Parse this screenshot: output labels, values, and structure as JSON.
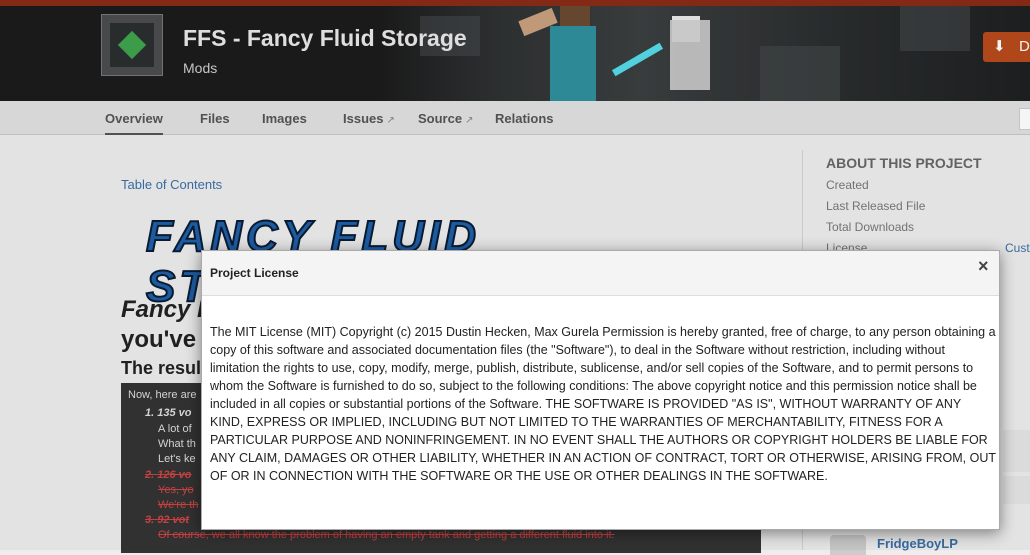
{
  "project": {
    "title": "FFS - Fancy Fluid Storage",
    "category": "Mods",
    "download_label": "D"
  },
  "nav": {
    "tabs": [
      {
        "label": "Overview",
        "external": false
      },
      {
        "label": "Files",
        "external": false
      },
      {
        "label": "Images",
        "external": false
      },
      {
        "label": "Issues",
        "external": true
      },
      {
        "label": "Source",
        "external": true
      },
      {
        "label": "Relations",
        "external": false
      }
    ],
    "external_icon": "external-link-icon"
  },
  "content": {
    "toc_label": "Table of Contents",
    "banner_text": "FANCY FLUID STORAGE",
    "heading_line1": "Fancy F",
    "heading_line2": "you've",
    "results_heading": "The resul",
    "list_intro": "Now, here are",
    "list": [
      {
        "num": "1.",
        "text": "135 vo",
        "struck": false
      },
      {
        "num": "",
        "text": "A lot of",
        "struck": false
      },
      {
        "num": "",
        "text": "What th",
        "struck": false
      },
      {
        "num": "",
        "text": "Let's ke",
        "struck": false
      },
      {
        "num": "2.",
        "text": "126 vo",
        "struck": true
      },
      {
        "num": "",
        "text": "Yes, yo",
        "struck": true
      },
      {
        "num": "",
        "text": "We're th",
        "struck": true
      },
      {
        "num": "3.",
        "text": "92 vot",
        "struck": true
      },
      {
        "num": "",
        "text": "Of course, we all know the problem of having an empty tank and getting a different fluid into it.",
        "struck": true
      }
    ]
  },
  "sidebar": {
    "title": "ABOUT THIS PROJECT",
    "rows": [
      "Created",
      "Last Released File",
      "Total Downloads",
      "License"
    ],
    "license_link": "Cust",
    "member_name": "FridgeBoyLP"
  },
  "modal": {
    "title": "Project License",
    "close_glyph": "×",
    "body": "The MIT License (MIT) Copyright (c) 2015 Dustin Hecken, Max Gurela Permission is hereby granted, free of charge, to any person obtaining a copy of this software and associated documentation files (the \"Software\"), to deal in the Software without restriction, including without limitation the rights to use, copy, modify, merge, publish, distribute, sublicense, and/or sell copies of the Software, and to permit persons to whom the Software is furnished to do so, subject to the following conditions: The above copyright notice and this permission notice shall be included in all copies or substantial portions of the Software. THE SOFTWARE IS PROVIDED \"AS IS\", WITHOUT WARRANTY OF ANY KIND, EXPRESS OR IMPLIED, INCLUDING BUT NOT LIMITED TO THE WARRANTIES OF MERCHANTABILITY, FITNESS FOR A PARTICULAR PURPOSE AND NONINFRINGEMENT. IN NO EVENT SHALL THE AUTHORS OR COPYRIGHT HOLDERS BE LIABLE FOR ANY CLAIM, DAMAGES OR OTHER LIABILITY, WHETHER IN AN ACTION OF CONTRACT, TORT OR OTHERWISE, ARISING FROM, OUT OF OR IN CONNECTION WITH THE SOFTWARE OR THE USE OR OTHER DEALINGS IN THE SOFTWARE."
  },
  "colors": {
    "accent_download": "#b84a1c",
    "link": "#3b6fa6",
    "header_bg": "#1c1c1c"
  }
}
